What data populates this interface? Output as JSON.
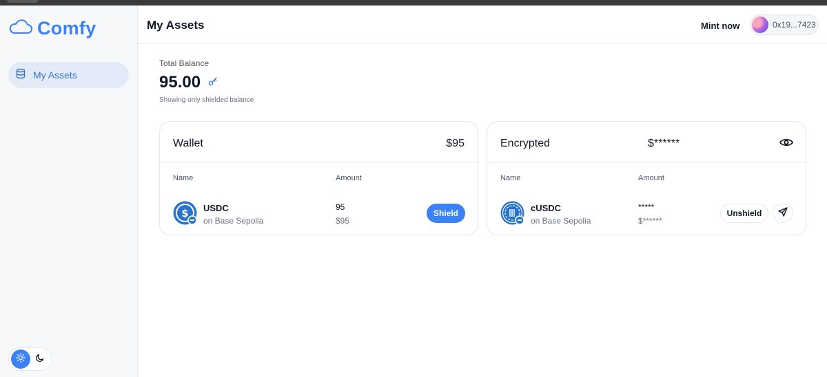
{
  "brand": {
    "name": "Comfy",
    "icon": "cloud-icon",
    "color": "#3b82f6"
  },
  "sidebar": {
    "items": [
      {
        "label": "My Assets",
        "icon": "database-icon",
        "active": true
      }
    ],
    "theme": {
      "options": [
        "light",
        "dark"
      ],
      "selected": "light"
    }
  },
  "header": {
    "title": "My Assets",
    "mint_label": "Mint now",
    "wallet_address": "0x19...7423"
  },
  "balance": {
    "label": "Total Balance",
    "value": "95.00",
    "note": "Showing only shielded balance"
  },
  "wallet_card": {
    "title": "Wallet",
    "total": "$95",
    "columns": [
      "Name",
      "Amount"
    ],
    "rows": [
      {
        "token": "USDC",
        "chain": "on Base Sepolia",
        "amount": "95",
        "amount_usd": "$95",
        "action": "Shield"
      }
    ]
  },
  "encrypted_card": {
    "title": "Encrypted",
    "total": "$******",
    "columns": [
      "Name",
      "Amount"
    ],
    "rows": [
      {
        "token": "cUSDC",
        "chain": "on Base Sepolia",
        "amount": "*****",
        "amount_usd": "$******",
        "action": "Unshield"
      }
    ]
  },
  "colors": {
    "accent": "#3b82f6",
    "sidebar_active_bg": "#e3ebf8"
  }
}
